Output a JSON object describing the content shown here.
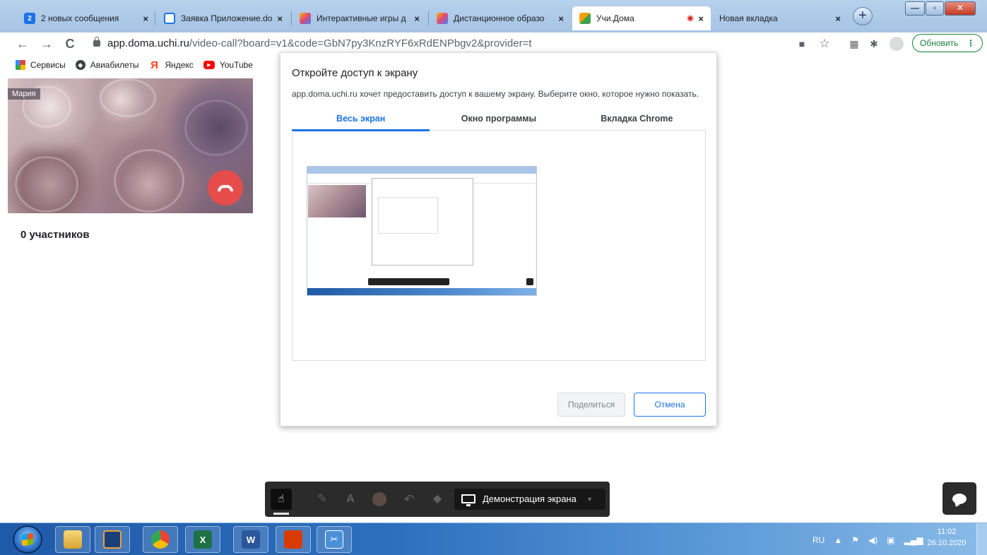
{
  "browser": {
    "tabs": [
      {
        "title": "2 новых сообщения",
        "badge": "2",
        "favicon": "message-icon",
        "color": "#1a73e8"
      },
      {
        "title": "Заявка Приложение.do",
        "favicon": "mail-icon",
        "color": "#1a73e8"
      },
      {
        "title": "Интерактивные игры д",
        "favicon": "game-icon",
        "color": "#e0487c"
      },
      {
        "title": "Дистанционное образо",
        "favicon": "game-icon",
        "color": "#e0487c"
      },
      {
        "title": "Учи.Дома",
        "favicon": "cube-icon",
        "color": "#f4a100",
        "active": true,
        "recording": true
      },
      {
        "title": "Новая вкладка",
        "favicon": "",
        "color": ""
      }
    ],
    "tab_close_glyph": "×",
    "new_tab_glyph": "+",
    "address": {
      "host": "app.doma.uchi.ru",
      "path": "/video-call?board=v1&code=GbN7py3KnzRYF6xRdENPbgv2&provider=t"
    },
    "update_label": "Обновить",
    "bookmarks": [
      {
        "label": "Сервисы",
        "icon": "apps-grid-icon"
      },
      {
        "label": "Авиабилеты",
        "icon": "globe-icon"
      },
      {
        "label": "Яндекс",
        "icon": "yandex-icon"
      },
      {
        "label": "YouTube",
        "icon": "youtube-icon"
      }
    ]
  },
  "video_tile": {
    "participant_name": "Мария"
  },
  "participants_label": "0 участников",
  "dialog": {
    "title": "Откройте доступ к экрану",
    "description": "app.doma.uchi.ru хочет предоставить доступ к вашему экрану. Выберите окно, которое нужно показать.",
    "tabs": [
      {
        "label": "Весь экран",
        "active": true
      },
      {
        "label": "Окно программы"
      },
      {
        "label": "Вкладка Chrome"
      }
    ],
    "share_button": "Поделиться",
    "cancel_button": "Отмена"
  },
  "dock": {
    "screen_share_label": "Демонстрация экрана",
    "tools": [
      "hand-icon",
      "pencil-icon",
      "text-icon",
      "color-icon",
      "undo-icon",
      "eraser-icon"
    ],
    "selected_color": "#5c4b45"
  },
  "taskbar": {
    "apps": [
      "explorer",
      "media",
      "chrome",
      "excel",
      "word",
      "reader",
      "snipping"
    ],
    "language": "RU",
    "time": "11:02",
    "date": "26.10.2020"
  },
  "colors": {
    "accent": "#1a73e8",
    "hangup": "#e74c4c",
    "update": "#188038"
  }
}
